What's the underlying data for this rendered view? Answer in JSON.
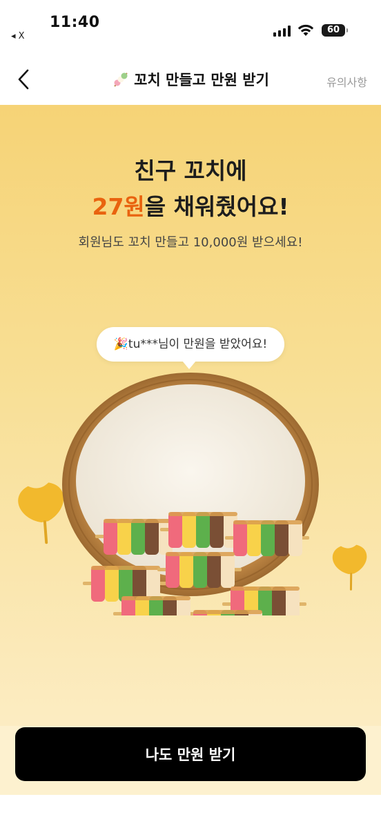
{
  "status_bar": {
    "time": "11:40",
    "back_app": "◂ X",
    "battery": "60"
  },
  "nav": {
    "title_emoji": "🍡",
    "title": "꼬치 만들고 만원 받기",
    "right_link": "유의사항"
  },
  "hero": {
    "line1": "친구 꼬치에",
    "amount": "27원",
    "line2_suffix": "을 채워줬어요!",
    "subtitle": "회원님도 꼬치 만들고 10,000원 받으세요!"
  },
  "bubble": {
    "emoji": "🎉",
    "text": "tu***님이 만원을 받았어요!"
  },
  "cta": {
    "label": "나도 만원 받기"
  },
  "colors": {
    "accent": "#e9630f",
    "cta_bg": "#000000",
    "bg_top": "#f6d376",
    "bg_bottom": "#fdf1cf"
  }
}
